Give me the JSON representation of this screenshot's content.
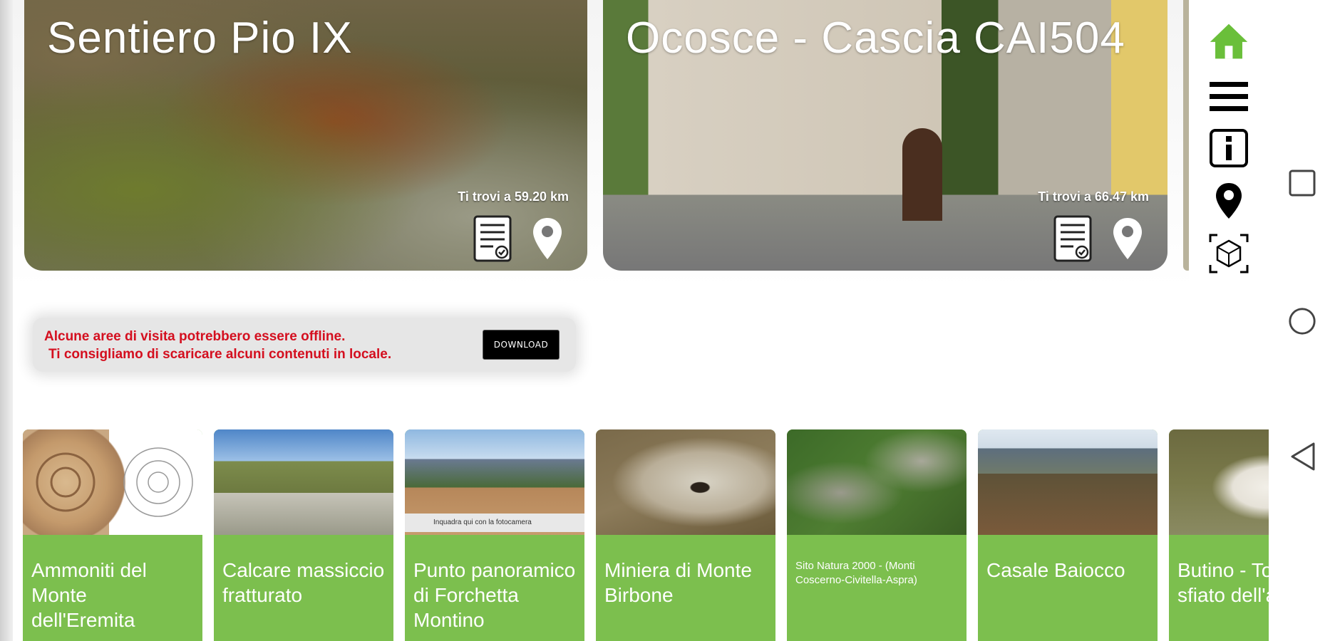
{
  "cards": [
    {
      "title": "Sentiero Pio IX",
      "distance": "Ti trovi a 59.20 km"
    },
    {
      "title": "Ocosce - Cascia CAI504",
      "distance": "Ti trovi a 66.47 km"
    }
  ],
  "side_menu": [
    "home-icon",
    "hamburger-menu-icon",
    "info-icon",
    "location-pin-icon",
    "ar-icon"
  ],
  "banner": {
    "line1": "Alcune aree di visita potrebbero essere offline.",
    "line2": "Ti consigliamo di scaricare alcuni contenuti in locale.",
    "download_label": "DOWNLOAD"
  },
  "tiles": [
    {
      "caption": "Ammoniti del Monte dell'Eremita"
    },
    {
      "caption": "Calcare massiccio fratturato"
    },
    {
      "caption": "Punto panoramico di Forchetta Montino",
      "image_text": "Inquadra qui con la fotocamera"
    },
    {
      "caption": "Miniera di Monte Birbone"
    },
    {
      "caption": "Sito Natura 2000 - (Monti Coscerno-Civitella-Aspra)"
    },
    {
      "caption": "Casale Baiocco"
    },
    {
      "caption": "Butino - Torretta sfiato dell'acq"
    }
  ],
  "colors": {
    "accent_green": "#7cbf4e",
    "banner_red": "#d40f1f",
    "home_green": "#6abf3a"
  }
}
